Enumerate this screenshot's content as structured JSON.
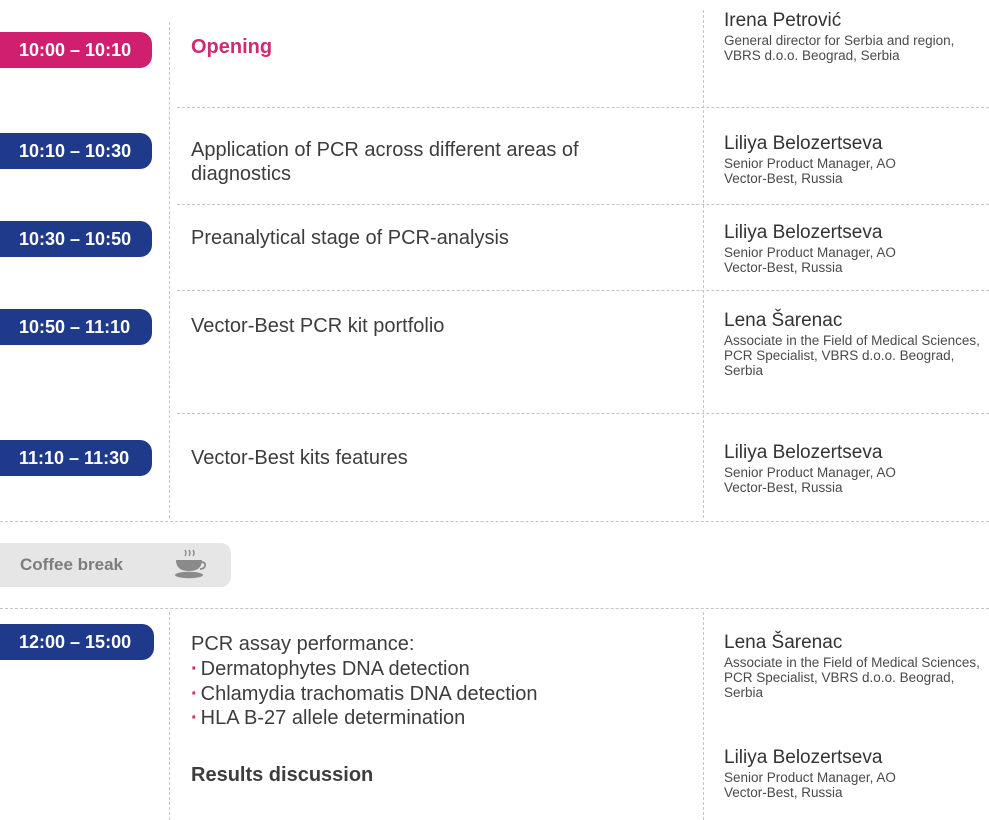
{
  "schedule": [
    {
      "time": "10:00 – 10:10",
      "title": "Opening",
      "speaker": "Irena Petrović",
      "role": "General director for Serbia and region, VBRS d.o.o. Beograd, Serbia"
    },
    {
      "time": "10:10 – 10:30",
      "title": "Application of PCR across different areas of diagnostics",
      "speaker": "Liliya Belozertseva",
      "role": "Senior Product Manager, AO Vector-Best, Russia"
    },
    {
      "time": "10:30 – 10:50",
      "title": "Preanalytical stage of PCR-analysis",
      "speaker": "Liliya Belozertseva",
      "role": "Senior Product Manager, AO Vector-Best, Russia"
    },
    {
      "time": "10:50 – 11:10",
      "title": "Vector-Best PCR kit portfolio",
      "speaker": "Lena Šarenac",
      "role": "Associate in the Field of Medical Sciences, PCR Specialist, VBRS d.o.o. Beograd, Serbia"
    },
    {
      "time": "11:10 – 11:30",
      "title": "Vector-Best kits features",
      "speaker": "Liliya Belozertseva",
      "role": "Senior Product Manager, AO Vector-Best, Russia"
    }
  ],
  "coffee_break": {
    "label": "Coffee break",
    "icon": "coffee-cup-icon"
  },
  "afternoon": {
    "time": "12:00 – 15:00",
    "title": "PCR assay performance:",
    "items": [
      "Dermatophytes DNA detection",
      "Chlamydia trachomatis DNA detection",
      "HLA B-27 allele determination"
    ],
    "discussion": "Results discussion",
    "speakers": [
      {
        "name": "Lena Šarenac",
        "role": "Associate in the Field of Medical Sciences, PCR Specialist, VBRS d.o.o. Beograd, Serbia"
      },
      {
        "name": "Liliya Belozertseva",
        "role": "Senior Product Manager, AO Vector-Best, Russia"
      }
    ]
  },
  "colors": {
    "accent_pink": "#d01f6e",
    "accent_blue": "#1f3a8a",
    "break_gray": "#e6e6e6",
    "text": "#3d3d3d"
  }
}
